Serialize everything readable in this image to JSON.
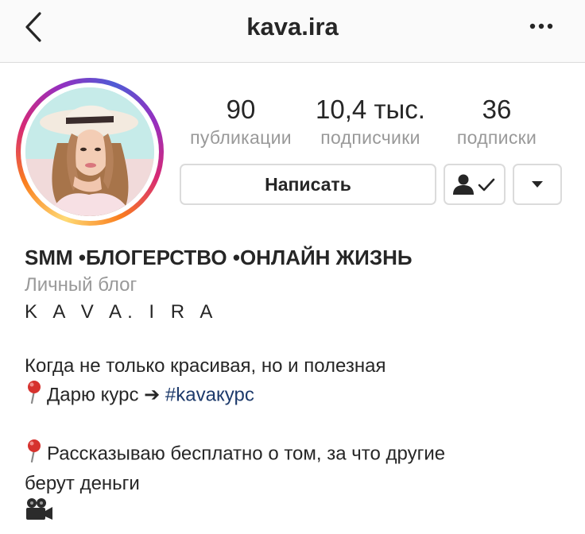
{
  "header": {
    "title": "kava.ira",
    "back_icon": "chevron-left-icon",
    "more_icon": "more-dots-icon"
  },
  "profile": {
    "avatar_icon": "profile-avatar",
    "stats": [
      {
        "value": "90",
        "label": "публикации"
      },
      {
        "value": "10,4 тыс.",
        "label": "подписчики"
      },
      {
        "value": "36",
        "label": "подписки"
      }
    ],
    "message_button": "Написать",
    "following_icon": "person-check-icon",
    "dropdown_icon": "triangle-down-icon"
  },
  "bio": {
    "name": "SMM •БЛОГЕРСТВО •ОНЛАЙН ЖИЗНЬ",
    "category": "Личный блог",
    "brand": "K A V A. I R A",
    "line1": "Когда не только красивая, но и полезная",
    "line2_text": "Дарю курс",
    "line2_arrow": "➔",
    "hashtag": "#kavaкурс",
    "line3": "Рассказываю бесплатно о том, за что другие",
    "line4": "берут деньги",
    "pin_icon": "pushpin-icon",
    "camera_icon": "movie-camera-icon"
  },
  "colors": {
    "text": "#262626",
    "secondary": "#999999",
    "hashtag": "#1d3a6b",
    "border": "#dbdbdb"
  }
}
